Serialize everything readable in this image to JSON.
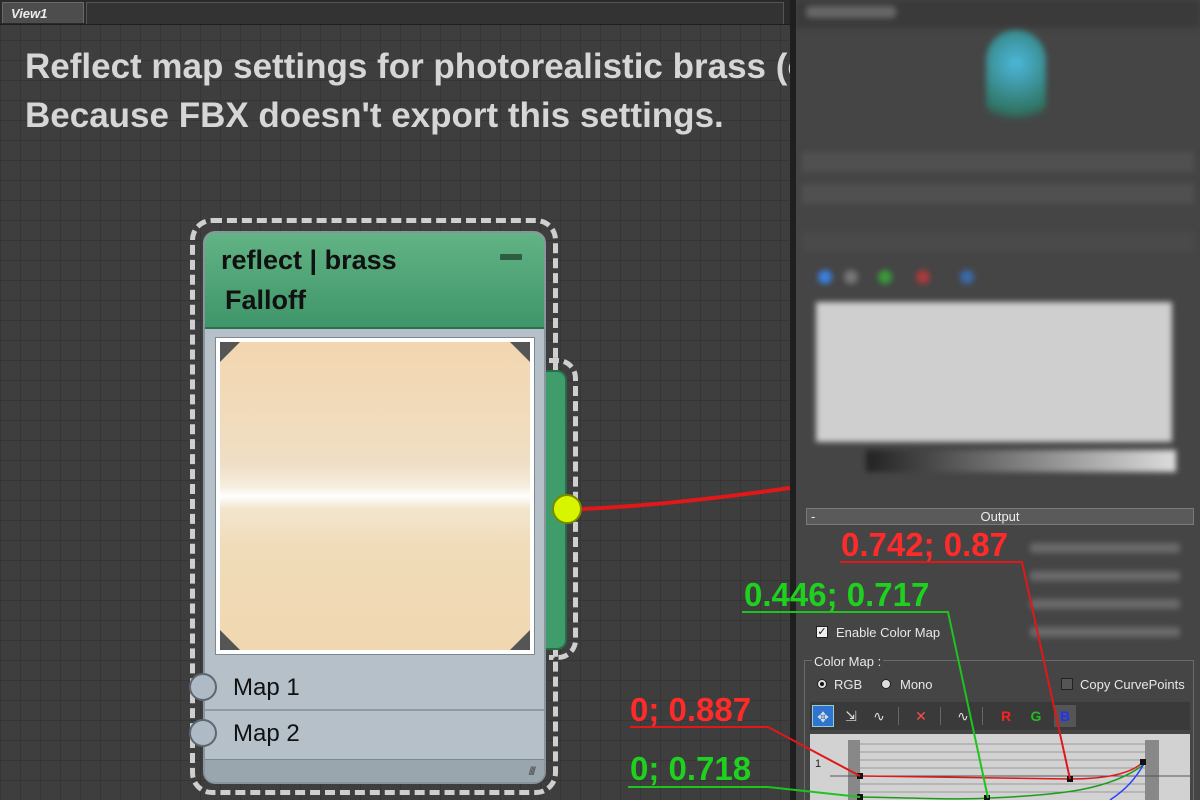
{
  "viewport": {
    "tab_label": "View1",
    "headline_line1": "Reflect map settings for photorealistic brass (only for FBX).",
    "headline_line2": "Because FBX doesn't export this settings."
  },
  "node": {
    "title": "reflect | brass",
    "subtitle": "Falloff",
    "map1_label": "Map 1",
    "map2_label": "Map 2"
  },
  "panel": {
    "output_label": "Output",
    "enable_color_map_label": "Enable Color Map",
    "color_map_label": "Color Map :",
    "rgb_label": "RGB",
    "mono_label": "Mono",
    "copy_curvepoints_label": "Copy CurvePoints",
    "curve_axis_label": "1",
    "toolbar": {
      "r_label": "R",
      "g_label": "G",
      "b_label": "B"
    }
  },
  "annotations": {
    "red_high": "0.742; 0.87",
    "green_high": "0.446; 0.717",
    "red_low": "0; 0.887",
    "green_low": "0; 0.718"
  },
  "colors": {
    "annotation_red": "#ff2a2a",
    "annotation_green": "#1fd11f",
    "node_header": "#4fa576",
    "output_socket": "#d8f500",
    "wire": "#e01818"
  }
}
